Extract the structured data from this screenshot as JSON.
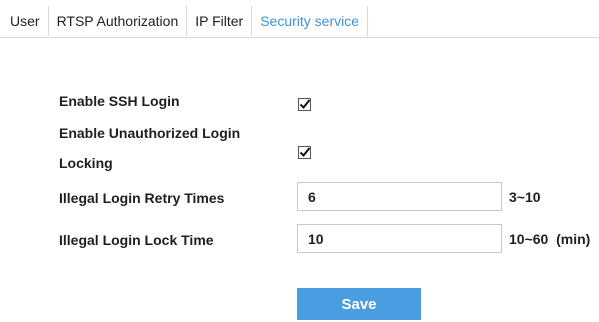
{
  "tabs": [
    {
      "label": "User",
      "active": false
    },
    {
      "label": "RTSP Authorization",
      "active": false
    },
    {
      "label": "IP Filter",
      "active": false
    },
    {
      "label": "Security service",
      "active": true
    }
  ],
  "form": {
    "ssh_login": {
      "label": "Enable SSH Login",
      "checked": true
    },
    "unauth_locking": {
      "label_line1": "Enable Unauthorized Login",
      "label_line2": "Locking",
      "checked": true
    },
    "retry_times": {
      "label": "Illegal Login Retry Times",
      "value": "6",
      "hint": "3~10"
    },
    "lock_time": {
      "label": "Illegal Login Lock Time",
      "value": "10",
      "hint": "10~60  (min)"
    },
    "save_label": "Save"
  },
  "colors": {
    "accent": "#3f93d9",
    "button": "#4a9de0",
    "border": "#d9d9d9"
  }
}
